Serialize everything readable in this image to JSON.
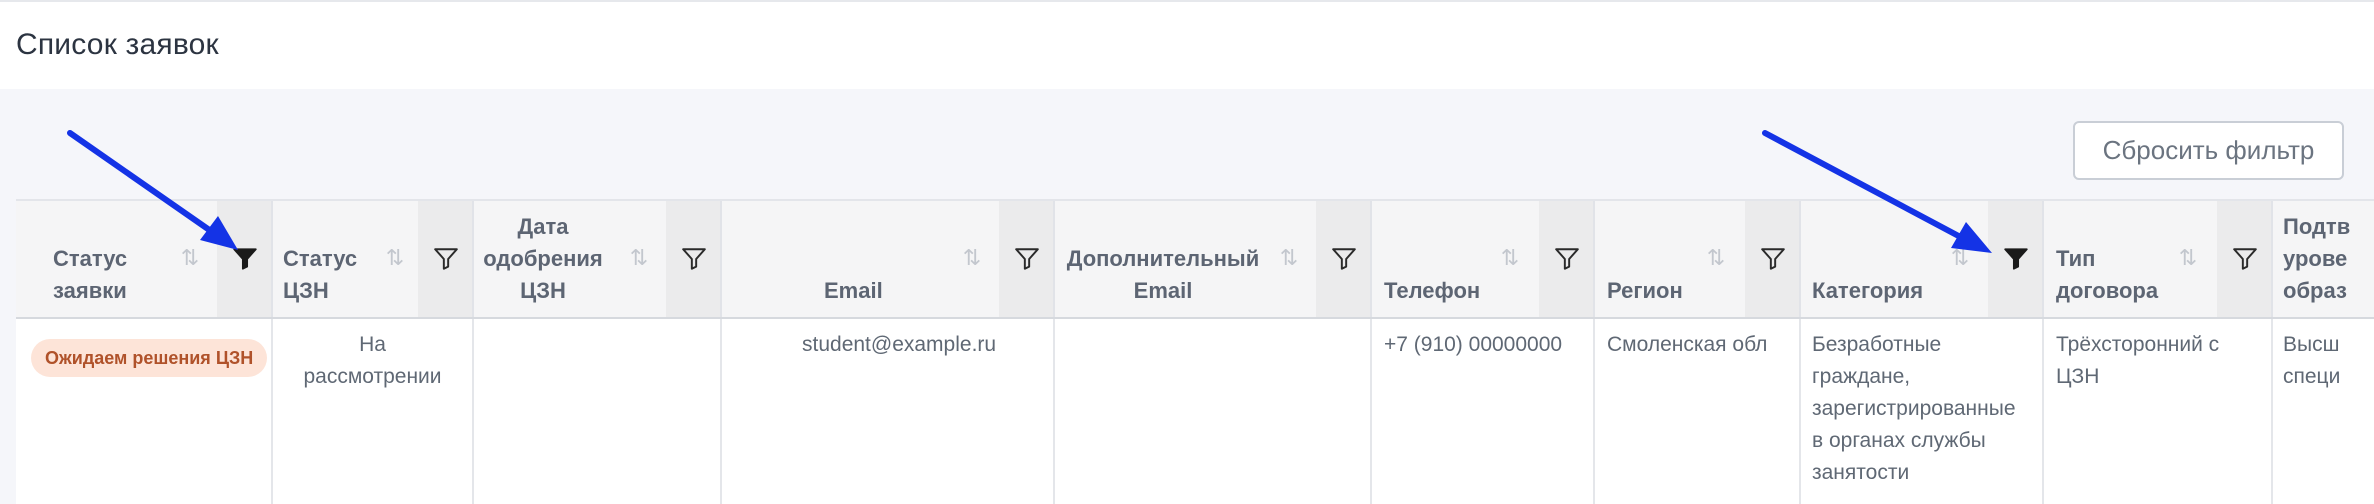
{
  "page": {
    "title": "Список заявок"
  },
  "toolbar": {
    "reset_filter_label": "Сбросить фильтр"
  },
  "colors": {
    "arrow": "#1433e6",
    "badge_bg": "#fde4d8",
    "badge_text": "#b0522a"
  },
  "table": {
    "columns": [
      {
        "line1": "Статус",
        "line2": "заявки",
        "line3": "",
        "filter_active": true
      },
      {
        "line1": "Статус",
        "line2": "ЦЗН",
        "line3": "",
        "filter_active": false
      },
      {
        "line1": "Дата",
        "line2": "одобрения",
        "line3": "ЦЗН",
        "filter_active": false
      },
      {
        "line1": "Email",
        "line2": "",
        "line3": "",
        "filter_active": false
      },
      {
        "line1": "Дополнительный",
        "line2": "Email",
        "line3": "",
        "filter_active": false
      },
      {
        "line1": "Телефон",
        "line2": "",
        "line3": "",
        "filter_active": false
      },
      {
        "line1": "Регион",
        "line2": "",
        "line3": "",
        "filter_active": false
      },
      {
        "line1": "Категория",
        "line2": "",
        "line3": "",
        "filter_active": true
      },
      {
        "line1": "Тип",
        "line2": "договора",
        "line3": "",
        "filter_active": false
      },
      {
        "line1": "Подтв",
        "line2": "урове",
        "line3": "образ",
        "filter_active": false
      }
    ],
    "sort_icon": "sort-arrows-icon",
    "filter_icon": "filter-funnel-icon",
    "row": {
      "status_badge": "Ожидаем решения ЦЗН",
      "czn_status": [
        "На",
        "рассмотрении"
      ],
      "approval_date": "",
      "email": "student@example.ru",
      "additional_email": "",
      "phone": "+7 (910) 00000000",
      "region": "Смоленская обл",
      "category": [
        "Безработные",
        "граждане,",
        "зарегистрированные",
        "в органах службы",
        "занятости"
      ],
      "contract_type": [
        "Трёхсторонний с",
        "ЦЗН"
      ],
      "confirmation": [
        "Высш",
        "специ"
      ]
    }
  }
}
